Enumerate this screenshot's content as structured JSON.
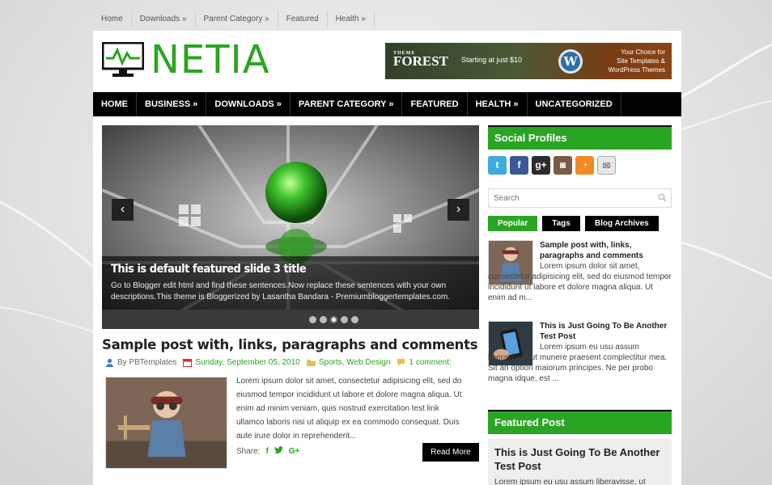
{
  "top_nav": [
    "Home",
    "Downloads »",
    "Parent Category »",
    "Featured",
    "Health »"
  ],
  "logo": {
    "text": "NETIA"
  },
  "banner": {
    "brand_small": "THEME",
    "brand": "FOREST",
    "starting": "Starting at just $10",
    "choice_line1": "Your Choice for",
    "choice_line2": "Site Templates &",
    "choice_line3": "WordPress Themes",
    "colors": {
      "bg": "#3f4c2f",
      "accent": "#8a4414"
    }
  },
  "main_nav": [
    "HOME",
    "BUSINESS »",
    "DOWNLOADS »",
    "PARENT CATEGORY »",
    "FEATURED",
    "HEALTH »",
    "UNCATEGORIZED"
  ],
  "slider": {
    "title": "This is default featured slide 3 title",
    "desc": "Go to Blogger edit html and find these sentences.Now replace these sentences with your own descriptions.This theme is Bloggerized by Lasantha Bandara - Premiumbloggertemplates.com.",
    "prev": "‹",
    "next": "›",
    "active_dot": 3,
    "dot_count": 5
  },
  "post": {
    "title": "Sample post with, links, paragraphs and comments",
    "author": "By PBTemplates",
    "date": "Sunday, September 05, 2010",
    "labels": "Sports, Web Design",
    "comments": "1 comment:",
    "excerpt": "Lorem ipsum dolor sit amet, consectetur adipisicing elit, sed do eiusmod tempor incididunt ut labore et dolore magna aliqua. Ut enim ad minim veniam, quis nostrud exercitation test link ullamco laboris nisi ut aliquip ex ea commodo consequat. Duis aute irure dolor in reprehenderit...",
    "share_label": "Share:",
    "share_icons": [
      "f",
      "t",
      "G+"
    ],
    "read_more": "Read More"
  },
  "sidebar": {
    "social_title": "Social Profiles",
    "social_icons": [
      {
        "name": "twitter-icon",
        "glyph": "t",
        "color": "#3fa9e0"
      },
      {
        "name": "facebook-icon",
        "glyph": "f",
        "color": "#3b5998"
      },
      {
        "name": "google-plus-icon",
        "glyph": "g+",
        "color": "#2b2b2b"
      },
      {
        "name": "instagram-icon",
        "glyph": "◙",
        "color": "#7a5a45"
      },
      {
        "name": "rss-icon",
        "glyph": "◔",
        "color": "#f08a24"
      },
      {
        "name": "email-icon",
        "glyph": "✉",
        "color": "#e8e8e8"
      }
    ],
    "search_placeholder": "Search",
    "tabs": [
      "Popular",
      "Tags",
      "Blog Archives"
    ],
    "popular": [
      {
        "title": "Sample post with, links, paragraphs and comments",
        "text": "Lorem ipsum dolor sit amet, consectetur adipisicing elit, sed do eiusmod tempor incididunt ut labore et dolore magna aliqua. Ut enim ad m..."
      },
      {
        "title": "This is Just Going To Be Another Test Post",
        "text": "Lorem ipsum eu usu assum liberavisse, ut munere praesent complectitur mea. Sit an option maiorum principes. Ne per probo magna idque, est ..."
      }
    ],
    "featured_title": "Featured Post",
    "featured": {
      "title": "This is Just Going To Be Another Test Post",
      "text": "Lorem ipsum eu usu assum liberavisse, ut"
    }
  },
  "colors": {
    "accent": "#2aa523",
    "nav": "#000000"
  }
}
